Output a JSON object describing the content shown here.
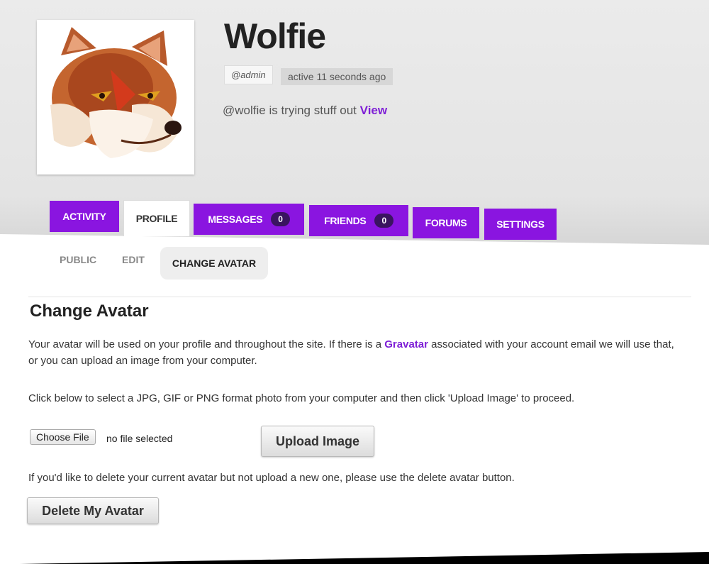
{
  "profile": {
    "name": "Wolfie",
    "role_badge": "@admin",
    "activity": "active 11 seconds ago",
    "status_text": "@wolfie is trying stuff out",
    "status_link": "View"
  },
  "tabs": [
    {
      "label": "ACTIVITY"
    },
    {
      "label": "PROFILE"
    },
    {
      "label": "MESSAGES",
      "count": "0"
    },
    {
      "label": "FRIENDS",
      "count": "0"
    },
    {
      "label": "FORUMS"
    },
    {
      "label": "SETTINGS"
    }
  ],
  "subnav": [
    {
      "label": "PUBLIC"
    },
    {
      "label": "EDIT"
    },
    {
      "label": "CHANGE AVATAR"
    }
  ],
  "content": {
    "heading": "Change Avatar",
    "intro_before": "Your avatar will be used on your profile and throughout the site. If there is a ",
    "intro_link": "Gravatar",
    "intro_after": " associated with your account email we will use that, or you can upload an image from your computer.",
    "instructions": "Click below to select a JPG, GIF or PNG format photo from your computer and then click 'Upload Image' to proceed.",
    "choose_file": "Choose File",
    "no_file": "no file selected",
    "upload_button": "Upload Image",
    "delete_text": "If you'd like to delete your current avatar but not upload a new one, please use the delete avatar button.",
    "delete_button": "Delete My Avatar"
  },
  "colors": {
    "accent": "#8a15e0",
    "link": "#7e1fd6",
    "pill": "#3a1460"
  },
  "icons": [
    "wolf-avatar-image"
  ]
}
